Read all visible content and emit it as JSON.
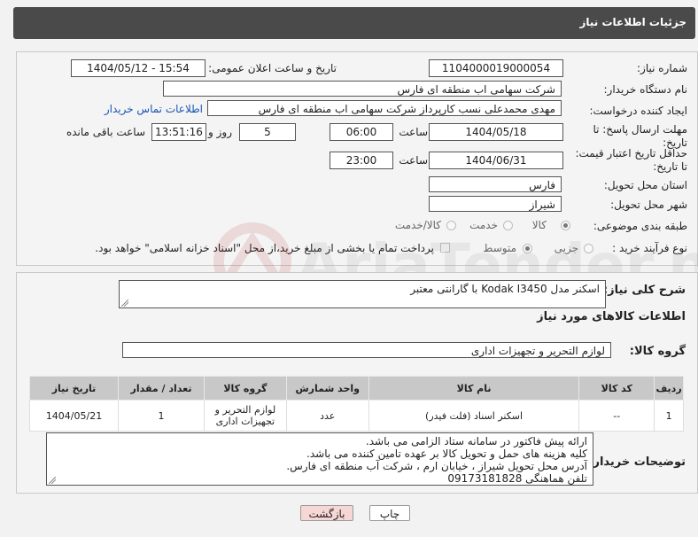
{
  "header": {
    "title": "جزئیات اطلاعات نیاز"
  },
  "fields": {
    "need_number": {
      "label": "شماره نیاز:",
      "value": "1104000019000054"
    },
    "announce_datetime": {
      "label": "تاریخ و ساعت اعلان عمومی:",
      "value": "1404/05/12 - 15:54"
    },
    "buyer_org": {
      "label": "نام دستگاه خریدار:",
      "value": "شرکت سهامی اب منطقه ای فارس"
    },
    "requester": {
      "label": "ایجاد کننده درخواست:",
      "value": "مهدی محمدعلی نسب کارپرداز شرکت سهامی اب منطقه ای فارس",
      "contact_link": "اطلاعات تماس خریدار"
    },
    "reply_deadline": {
      "label": "مهلت ارسال پاسخ: تا تاریخ:",
      "date": "1404/05/18",
      "time_label": "ساعت",
      "time": "06:00",
      "days": "5",
      "days_label": "روز و",
      "remaining": "13:51:16",
      "remaining_label": "ساعت باقی مانده"
    },
    "price_validity": {
      "label": "حداقل تاریخ اعتبار قیمت: تا تاریخ:",
      "date": "1404/06/31",
      "time_label": "ساعت",
      "time": "23:00"
    },
    "province": {
      "label": "استان محل تحویل:",
      "value": "فارس"
    },
    "city": {
      "label": "شهر محل تحویل:",
      "value": "شیراز"
    },
    "category": {
      "label": "طبقه بندی موضوعی:",
      "options": [
        "کالا",
        "خدمت",
        "کالا/خدمت"
      ],
      "selected": "کالا"
    },
    "process_type": {
      "label": "نوع فرآیند خرید :",
      "options": [
        "جزیی",
        "متوسط"
      ],
      "selected": "متوسط",
      "payment_note": "پرداخت تمام یا بخشی از مبلغ خرید،از محل \"اسناد خزانه اسلامی\" خواهد بود."
    }
  },
  "description": {
    "label": "شرح کلی نیاز:",
    "value": "اسکنر مدل Kodak I3450 با گارانتی معتبر"
  },
  "goods_section": {
    "title": "اطلاعات کالاهای مورد نیاز",
    "group_label": "گروه کالا:",
    "group_value": "لوازم التحریر و تجهیزات اداری"
  },
  "table": {
    "columns": [
      "ردیف",
      "کد کالا",
      "نام کالا",
      "واحد شمارش",
      "گروه کالا",
      "تعداد / مقدار",
      "تاریخ نیاز"
    ],
    "rows": [
      [
        "1",
        "--",
        "اسکنر اسناد (فلت فیدر)",
        "عدد",
        "لوازم التحریر و تجهیزات اداری",
        "1",
        "1404/05/21"
      ]
    ]
  },
  "buyer_notes": {
    "label": "توضیحات خریدار:",
    "value": "ارائه پیش فاکتور در سامانه ستاد الزامی می باشد.\nکلیه هزینه های حمل و تحویل کالا بر عهده تامین کننده می باشد.\nآدرس محل تحویل شیراز ، خیابان ارم ، شرکت آب منطقه ای فارس.\nتلفن هماهنگی 09173181828"
  },
  "buttons": {
    "print": "چاپ",
    "back": "بازگشت"
  },
  "watermark": {
    "text": "AriaTender.neT"
  },
  "colors": {
    "header_bg": "#4a4a4a",
    "link": "#1a56b4",
    "back_button_bg": "#f7d6d6",
    "print_button_bg": "#ffffff",
    "table_header_bg": "#c8c8c8"
  }
}
